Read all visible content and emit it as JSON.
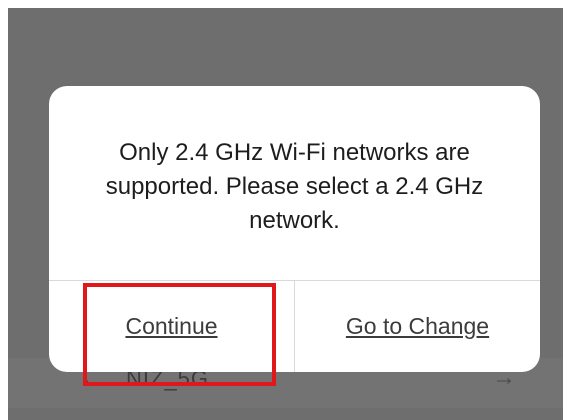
{
  "background": {
    "network_name": "NIZ_5G"
  },
  "dialog": {
    "message": "Only 2.4 GHz Wi-Fi networks are supported. Please select a 2.4 GHz network.",
    "continue_label": "Continue",
    "change_label": "Go to Change"
  },
  "colors": {
    "overlay": "#6f6e6e",
    "dialog_bg": "#ffffff",
    "highlight": "#e0181b",
    "text": "#1d1d1d"
  }
}
